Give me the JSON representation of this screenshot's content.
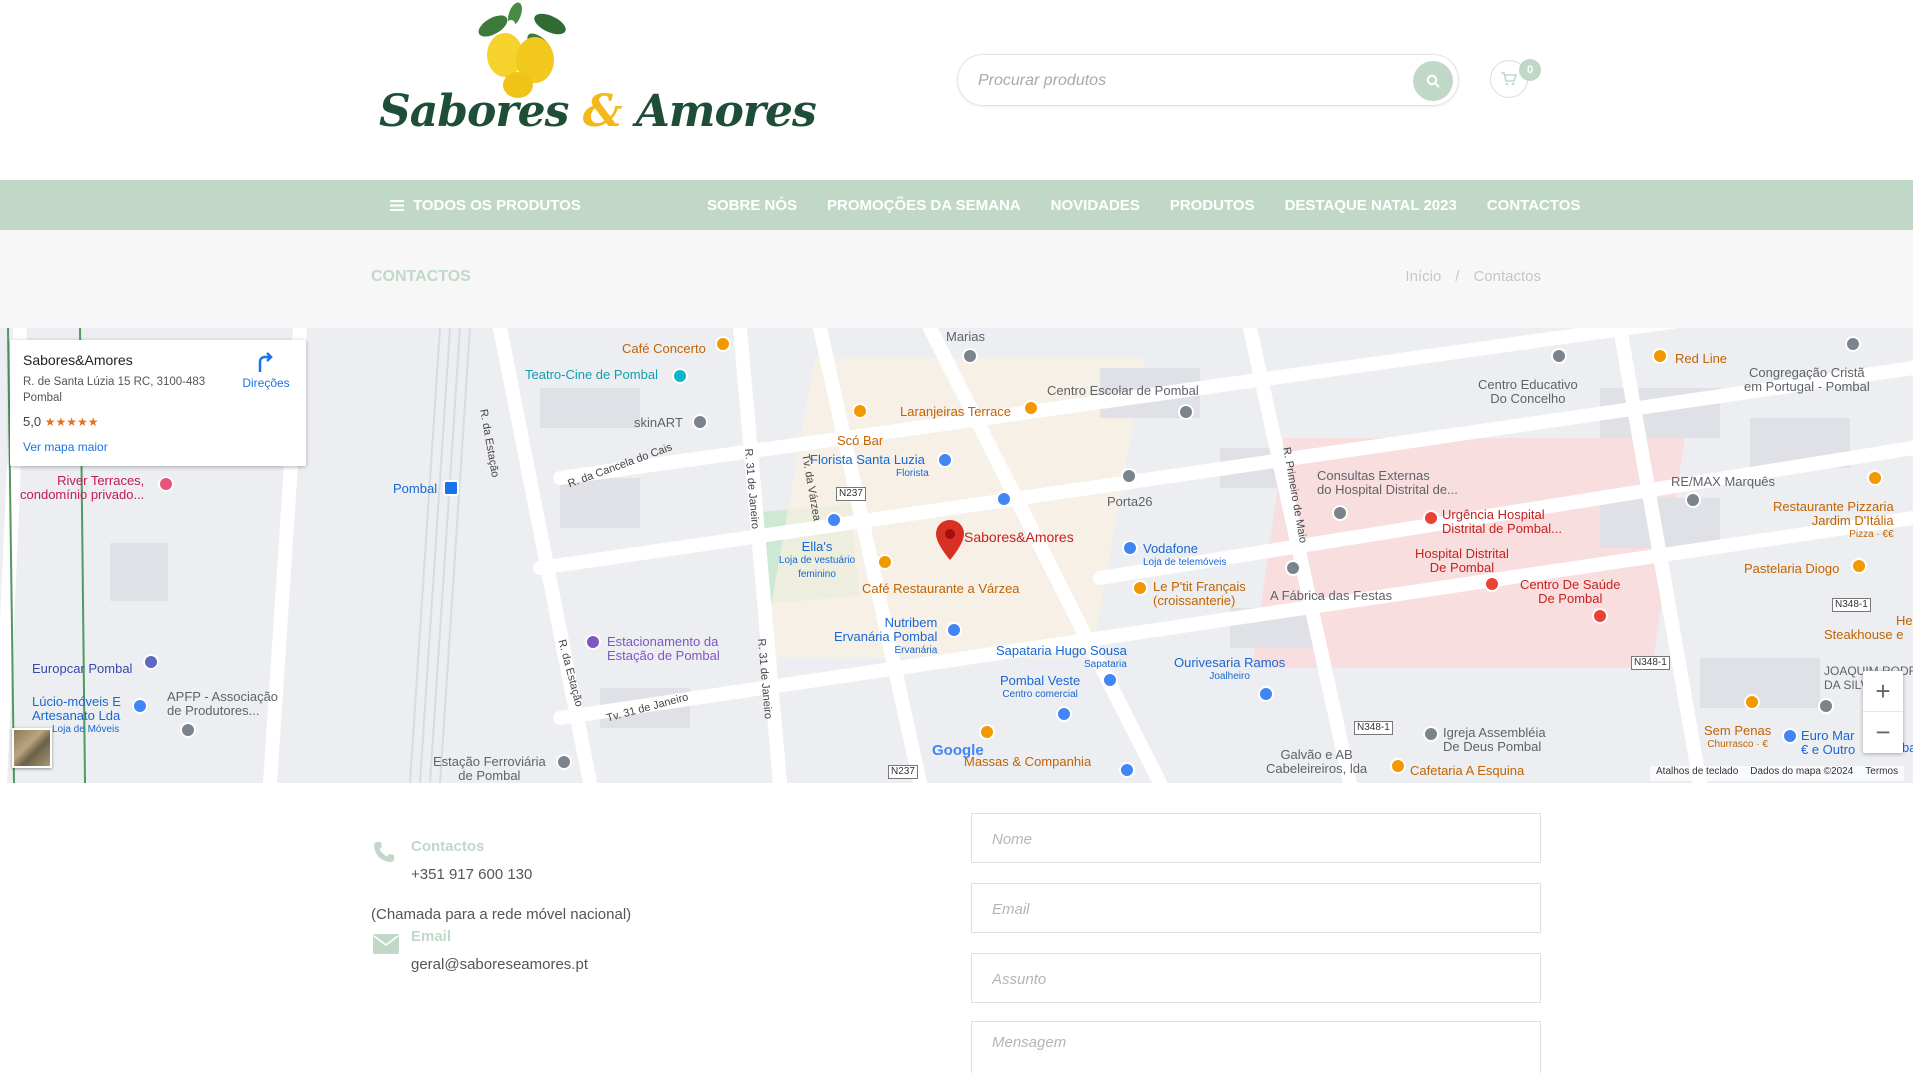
{
  "header": {
    "logo_word1": "Sabores",
    "logo_amp": "&",
    "logo_word2": "Amores",
    "search_placeholder": "Procurar produtos",
    "cart_count": "0"
  },
  "nav": {
    "all_products": "TODOS OS PRODUTOS",
    "links": [
      "SOBRE NÓS",
      "PROMOÇÕES DA SEMANA",
      "NOVIDADES",
      "PRODUTOS",
      "DESTAQUE NATAL 2023",
      "CONTACTOS"
    ]
  },
  "breadcrumb": {
    "page_title": "CONTACTOS",
    "home": "Início",
    "separator": "/",
    "current": "Contactos"
  },
  "map": {
    "card": {
      "title": "Sabores&Amores",
      "address": "R. de Santa Lúzia 15 RC, 3100-483 Pombal",
      "rating": "5,0",
      "stars": "★★★★★",
      "larger_map": "Ver mapa maior",
      "directions": "Direções"
    },
    "marker": "Sabores&Amores",
    "labels": {
      "cafe_concerto": "Café Concerto",
      "marias": "Marias",
      "teatro": "Teatro-Cine de Pombal",
      "skinart": "skinART",
      "laranjeiras": "Laranjeiras Terrace",
      "sco_bar": "Scó Bar",
      "florista": "Florista Santa Luzia",
      "florista_sub": "Florista",
      "centro_escolar": "Centro Escolar de Pombal",
      "centro_educativo": "Centro Educativo",
      "do_concelho": "Do Concelho",
      "congregacao": "Congregação Cristã",
      "congregacao2": "em Portugal - Pombal",
      "red_line": "Red Line",
      "consultas": "Consultas Externas",
      "consultas2": "do Hospital Distrital de...",
      "urgencia": "Urgência Hospital",
      "urgencia2": "Distrital de Pombal...",
      "remax": "RE/MAX Marquês",
      "restaurante_pizzaria": "Restaurante Pizzaria",
      "jardim_italia": "Jardim D'Itália",
      "pizza": "Pizza · €€",
      "pombal": "Pombal",
      "river": "River Terraces,",
      "river2": "condomínio privado...",
      "r_estacao": "R. da Estação",
      "r_cancela": "R. da Cancela do Cais",
      "r_31": "R. 31 de Janeiro",
      "tv_varzea": "Tv. da Várzea",
      "porta26": "Porta26",
      "r_primeiro": "R. Primeiro de Maio",
      "hospital_distrital": "Hospital Distrital",
      "de_pombal": "De Pombal",
      "centro_saude": "Centro De Saúde",
      "centro_saude2": "De Pombal",
      "pastelaria": "Pastelaria Diogo",
      "ellas": "Ella's",
      "ellas_sub": "Loja de vestuário feminino",
      "vodafone": "Vodafone",
      "vodafone_sub": "Loja de telemóveis",
      "cafe_varzea": "Café Restaurante a Várzea",
      "petit": "Le P'tit Français",
      "petit2": "(croissanterie)",
      "fabrica": "A Fábrica das Festas",
      "nutribem": "Nutribem",
      "ervanaria": "Ervanária Pombal",
      "ervanaria_sub": "Ervanária",
      "estacionamento": "Estacionamento da",
      "estacionamento2": "Estação de Pombal",
      "sapataria": "Sapataria Hugo Sousa",
      "sapataria_sub": "Sapataria",
      "ourivesaria": "Ourivesaria Ramos",
      "ourivesaria_sub": "Joalheiro",
      "pombal_veste": "Pombal Veste",
      "pombal_veste_sub": "Centro comercial",
      "steakhouse": "Steakhouse e",
      "hel": "Hel",
      "joaquim": "JOAQUIM RODRIG",
      "da_silva": "DA SILVA",
      "europcar": "Europcar Pombal",
      "lucio": "Lúcio-móveis E",
      "artesanato": "Artesanato Lda",
      "lucio_sub": "Loja de Móveis",
      "apfp": "APFP - Associação",
      "apfp2": "de Produtores...",
      "tv_31": "Tv. 31 de Janeiro",
      "r_estacao2": "R. da Estação",
      "r_31b": "R. 31 de Janeiro",
      "estacao": "Estação Ferroviária",
      "estacao2": "de Pombal",
      "massas": "Massas & Companhia",
      "galvao": "Galvão e AB",
      "galvao2": "Cabeleireiros, lda",
      "igreja": "Igreja Assembléia",
      "igreja2": "De Deus Pombal",
      "cafetaria": "Cafetaria A Esquina",
      "sem_penas": "Sem Penas",
      "sem_penas_sub": "Churrasco · €",
      "euro_mar": "Euro Mar",
      "euro_mar2": "€ e Outro",
      "ba": "ba",
      "n237a": "N237",
      "n237b": "N237",
      "n348a": "N348-1",
      "n348b": "N348-1",
      "n348c": "N348-1",
      "google": "Google"
    },
    "zoom_in": "+",
    "zoom_out": "−",
    "attribution": [
      "Atalhos de teclado",
      "Dados do mapa ©2024",
      "Termos"
    ]
  },
  "contact": {
    "phone_label": "Contactos",
    "phone": "+351 917 600 130",
    "phone_note": "(Chamada para a rede móvel nacional)",
    "email_label": "Email",
    "email": "geral@saboreseamores.pt"
  },
  "form": {
    "name_placeholder": "Nome",
    "email_placeholder": "Email",
    "subject_placeholder": "Assunto",
    "message_placeholder": "Mensagem"
  },
  "colors": {
    "accent": "#c1d8c9",
    "logo_green": "#1e4d38",
    "logo_yellow": "#f2b81c",
    "marker_red": "#d93025"
  }
}
